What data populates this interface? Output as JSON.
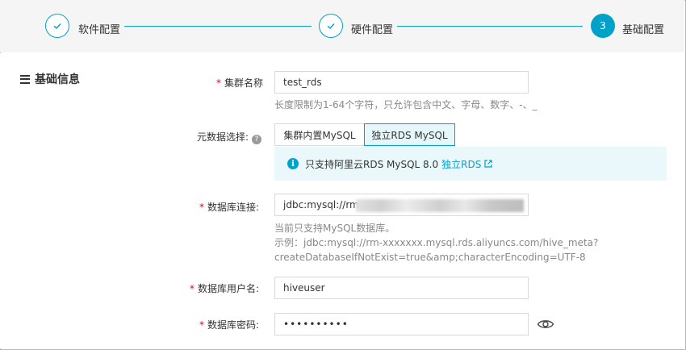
{
  "steps": [
    {
      "number": "1",
      "label": "软件配置",
      "state": "done"
    },
    {
      "number": "2",
      "label": "硬件配置",
      "state": "done"
    },
    {
      "number": "3",
      "label": "基础配置",
      "state": "active"
    }
  ],
  "section": {
    "title": "基础信息",
    "icon": "list-icon"
  },
  "cluster_name": {
    "label": "集群名称",
    "required_mark": "*",
    "value": "test_rds",
    "hint": "长度限制为1-64个字符，只允许包含中文、字母、数字、-、_"
  },
  "metadata": {
    "label": "元数据选择:",
    "help_icon": "?",
    "options": [
      "集群内置MySQL",
      "独立RDS MySQL"
    ],
    "selected": "独立RDS MySQL",
    "notice_text": "只支持阿里云RDS MySQL 8.0",
    "notice_link": "独立RDS",
    "notice_icon": "info-icon",
    "link_icon": "external-link-icon"
  },
  "db_connection": {
    "label": "数据库连接:",
    "required_mark": "*",
    "value": "jdbc:mysql://rm-",
    "hint_line1": "当前只支持MySQL数据库。",
    "hint_line2": "示例：jdbc:mysql://rm-xxxxxxx.mysql.rds.aliyuncs.com/hive_meta?",
    "hint_line3": "createDatabaseIfNotExist=true&amp;characterEncoding=UTF-8"
  },
  "db_user": {
    "label": "数据库用户名:",
    "required_mark": "*",
    "value": "hiveuser"
  },
  "db_password": {
    "label": "数据库密码:",
    "required_mark": "*",
    "value": "••••••••••",
    "toggle_icon": "eye-icon"
  },
  "colors": {
    "accent": "#00a2ca",
    "required": "#e5001d",
    "notice_bg": "#ebf8fb"
  }
}
